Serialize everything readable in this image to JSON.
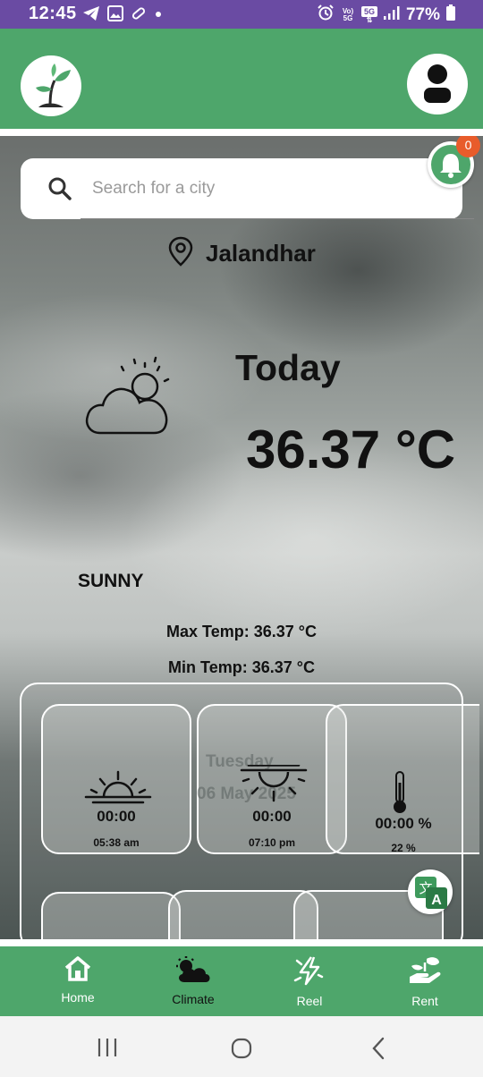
{
  "status_bar": {
    "time": "12:45",
    "left_icons": [
      "telegram-icon",
      "gallery-icon",
      "pill-icon",
      "dot-icon"
    ],
    "right_icons": [
      "alarm-icon",
      "volte-icon",
      "5g-icon",
      "signal-icon",
      "battery-icon"
    ],
    "volte_top": "Vo)",
    "volte_bottom": "5G",
    "network": "5G",
    "battery": "77%"
  },
  "header": {
    "logo_icon": "sprout-icon",
    "profile_icon": "user-icon",
    "color": "#4ea66b"
  },
  "search": {
    "placeholder": "Search for a city",
    "value": ""
  },
  "notification": {
    "count": "0",
    "icon": "bell-icon",
    "badge_color": "#e85c2b"
  },
  "location": {
    "icon": "map-pin-icon",
    "city": "Jalandhar"
  },
  "weather": {
    "icon": "partly-cloudy-icon",
    "day": "Today",
    "temperature": "36.37 °C",
    "condition": "SUNNY",
    "max_temp": "Max Temp: 36.37 °C",
    "min_temp": "Min Temp: 36.37 °C"
  },
  "cards": [
    {
      "icon": "sunrise-icon",
      "value": "00:00",
      "sub": "05:38 am"
    },
    {
      "icon": "sunset-icon",
      "value": "00:00",
      "sub": "07:10 pm"
    },
    {
      "icon": "thermometer-icon",
      "value": "00:00 %",
      "sub": "22 %"
    }
  ],
  "ghost_date": {
    "day": "Tuesday",
    "date": "06 May 2025"
  },
  "translate_icon": "translate-icon",
  "bottom_nav": [
    {
      "label": "Home",
      "icon": "home-icon",
      "active": false
    },
    {
      "label": "Climate",
      "icon": "climate-icon",
      "active": true
    },
    {
      "label": "Reel",
      "icon": "reel-icon",
      "active": false
    },
    {
      "label": "Rent",
      "icon": "rent-icon",
      "active": false
    }
  ],
  "system_nav": [
    "recents-icon",
    "home-circle-icon",
    "back-icon"
  ]
}
